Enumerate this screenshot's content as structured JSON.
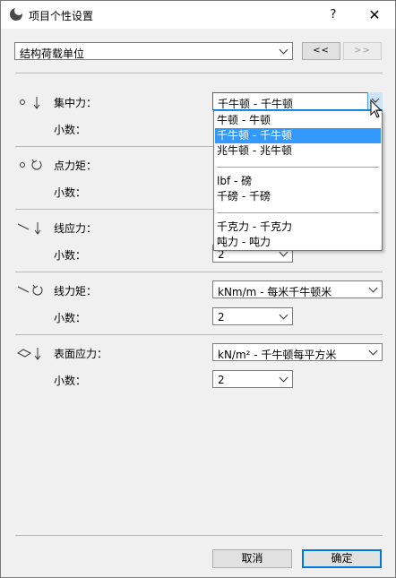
{
  "window": {
    "title": "项目个性设置",
    "help_label": "?",
    "close_label": "✕"
  },
  "top": {
    "category": "结构荷载单位",
    "prev_label": "<<",
    "next_label": ">>"
  },
  "rows": {
    "concentrated": {
      "label": "集中力：",
      "decimals_label": "小数：",
      "value": "千牛顿 - 千牛顿"
    },
    "point_moment": {
      "label": "点力矩：",
      "decimals_label": "小数："
    },
    "line_force": {
      "label": "线应力：",
      "decimals_label": "小数：",
      "decimals": "2"
    },
    "line_moment": {
      "label": "线力矩：",
      "decimals_label": "小数：",
      "value": "kNm/m - 每米千牛顿米",
      "decimals": "2"
    },
    "surface_force": {
      "label": "表面应力：",
      "decimals_label": "小数：",
      "value": "kN/m² - 千牛顿每平方米",
      "decimals": "2"
    }
  },
  "dropdown": {
    "options": [
      "牛顿 - 牛顿",
      "千牛顿 - 千牛顿",
      "兆牛顿 - 兆牛顿",
      "lbf - 磅",
      "千磅 - 千磅",
      "千克力 - 千克力",
      "吨力 - 吨力"
    ],
    "selected": "千牛顿 - 千牛顿"
  },
  "footer": {
    "cancel_label": "取消",
    "ok_label": "确定"
  },
  "colors": {
    "accent": "#0078d7",
    "selection": "#3399ff"
  },
  "icons": {
    "app": "archicad-logo-icon",
    "concentrated": "point-force-icon",
    "point_moment": "point-moment-icon",
    "line_force": "line-force-icon",
    "line_moment": "line-moment-icon",
    "surface_force": "surface-force-icon"
  }
}
